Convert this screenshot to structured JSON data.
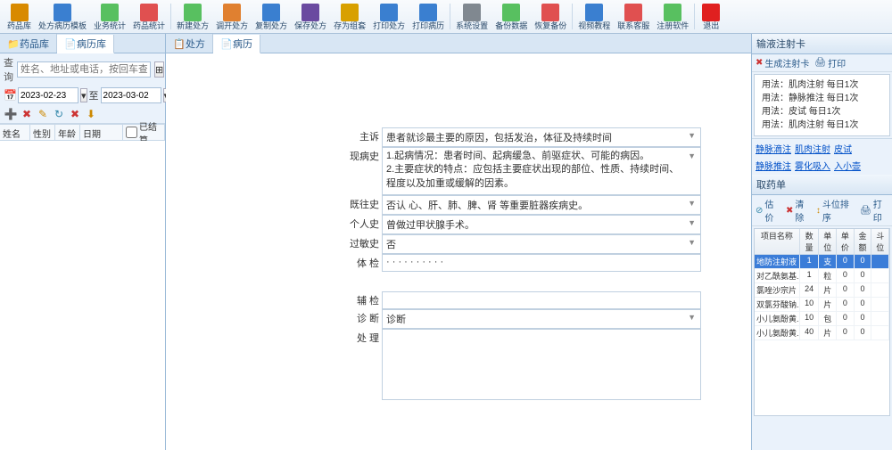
{
  "toolbar": [
    {
      "id": "drug-lib",
      "label": "药品库",
      "color": "#d88a00"
    },
    {
      "id": "template",
      "label": "处方病历模板",
      "color": "#3a7fd0"
    },
    {
      "id": "biz-stat",
      "label": "业务统计",
      "color": "#58c060"
    },
    {
      "id": "drug-stat",
      "label": "药品统计",
      "color": "#e05050"
    },
    {
      "sep": true
    },
    {
      "id": "new-rx",
      "label": "新建处方",
      "color": "#58c060"
    },
    {
      "id": "recall-rx",
      "label": "调开处方",
      "color": "#e08030"
    },
    {
      "id": "copy-rx",
      "label": "复制处方",
      "color": "#3a7fd0"
    },
    {
      "id": "save-rx",
      "label": "保存处方",
      "color": "#6a4aa0"
    },
    {
      "id": "save-group",
      "label": "存为组套",
      "color": "#d8a000"
    },
    {
      "id": "print-rx",
      "label": "打印处方",
      "color": "#3a7fd0"
    },
    {
      "id": "print-hist",
      "label": "打印病历",
      "color": "#3a7fd0"
    },
    {
      "sep": true
    },
    {
      "id": "sys-set",
      "label": "系统设置",
      "color": "#808890"
    },
    {
      "id": "backup",
      "label": "备份数据",
      "color": "#58c060"
    },
    {
      "id": "restore",
      "label": "恢复备份",
      "color": "#e05050"
    },
    {
      "sep": true
    },
    {
      "id": "video",
      "label": "视频教程",
      "color": "#3a7fd0"
    },
    {
      "id": "contact",
      "label": "联系客服",
      "color": "#e05050"
    },
    {
      "id": "register",
      "label": "注册软件",
      "color": "#58c060"
    },
    {
      "sep": true
    },
    {
      "id": "exit",
      "label": "退出",
      "color": "#e02020"
    }
  ],
  "left_tabs": {
    "drug": "药品库",
    "hist_lib": "病历库"
  },
  "search": {
    "label": "查询",
    "placeholder": "姓名、地址或电话，按回车查询"
  },
  "date": {
    "from": "2023-02-23",
    "to_label": "至",
    "to": "2023-03-02"
  },
  "list_header": {
    "name": "姓名",
    "sex": "性别",
    "age": "年龄",
    "date": "日期",
    "settled": "已结算"
  },
  "center_tabs": {
    "rx": "处方",
    "hist": "病历"
  },
  "form": {
    "chief_label": "主诉",
    "chief": "患者就诊最主要的原因，包括发治，体征及持续时间",
    "present_label": "现病史",
    "present": "1.起病情况：患者时间、起病缓急、前驱症状、可能的病因。\n2.主要症状的特点：应包括主要症状出现的部位、性质、持续时间、程度以及加重或缓解的因素。",
    "past_label": "既往史",
    "past": "否认 心、肝、肺、脾、肾 等重要脏器疾病史。",
    "personal_label": "个人史",
    "personal": "曾做过甲状腺手术。",
    "allergy_label": "过敏史",
    "allergy": "否",
    "exam_label": "体 检",
    "exam": "· · · · · · · · · ·",
    "aux_label": "辅 检",
    "aux": "",
    "diag_label": "诊 断",
    "diag": "诊断",
    "treat_label": "处 理",
    "treat": ""
  },
  "inj_card": {
    "title": "输液注射卡",
    "gen": "生成注射卡",
    "print": "打印",
    "lines": [
      "用法：肌肉注射    每日1次",
      "用法：静脉推注    每日1次",
      "用法：皮试  每日1次",
      "用法：肌肉注射    每日1次"
    ]
  },
  "links": [
    "静脉滴注",
    "肌肉注射",
    "皮试",
    "静脉推注",
    "雾化吸入",
    "入小壶"
  ],
  "med": {
    "title": "取药单",
    "toolbar": {
      "price": "估价",
      "clear": "清除",
      "sort": "斗位排序",
      "print": "打印"
    },
    "headers": {
      "name": "项目名称",
      "qty": "数量",
      "unit": "单位",
      "price": "单价",
      "amt": "金额",
      "pos": "斗位"
    },
    "rows": [
      {
        "name": "地防注射液",
        "qty": "1",
        "unit": "支",
        "price": "0",
        "amt": "0",
        "sel": true
      },
      {
        "name": "对乙酰氨基...",
        "qty": "1",
        "unit": "粒",
        "price": "0",
        "amt": "0"
      },
      {
        "name": "氯唑沙宗片",
        "qty": "24",
        "unit": "片",
        "price": "0",
        "amt": "0"
      },
      {
        "name": "双氯芬酸钠...",
        "qty": "10",
        "unit": "片",
        "price": "0",
        "amt": "0"
      },
      {
        "name": "小儿氨酚黄...",
        "qty": "10",
        "unit": "包",
        "price": "0",
        "amt": "0"
      },
      {
        "name": "小儿氨酚黄...",
        "qty": "40",
        "unit": "片",
        "price": "0",
        "amt": "0"
      }
    ]
  }
}
